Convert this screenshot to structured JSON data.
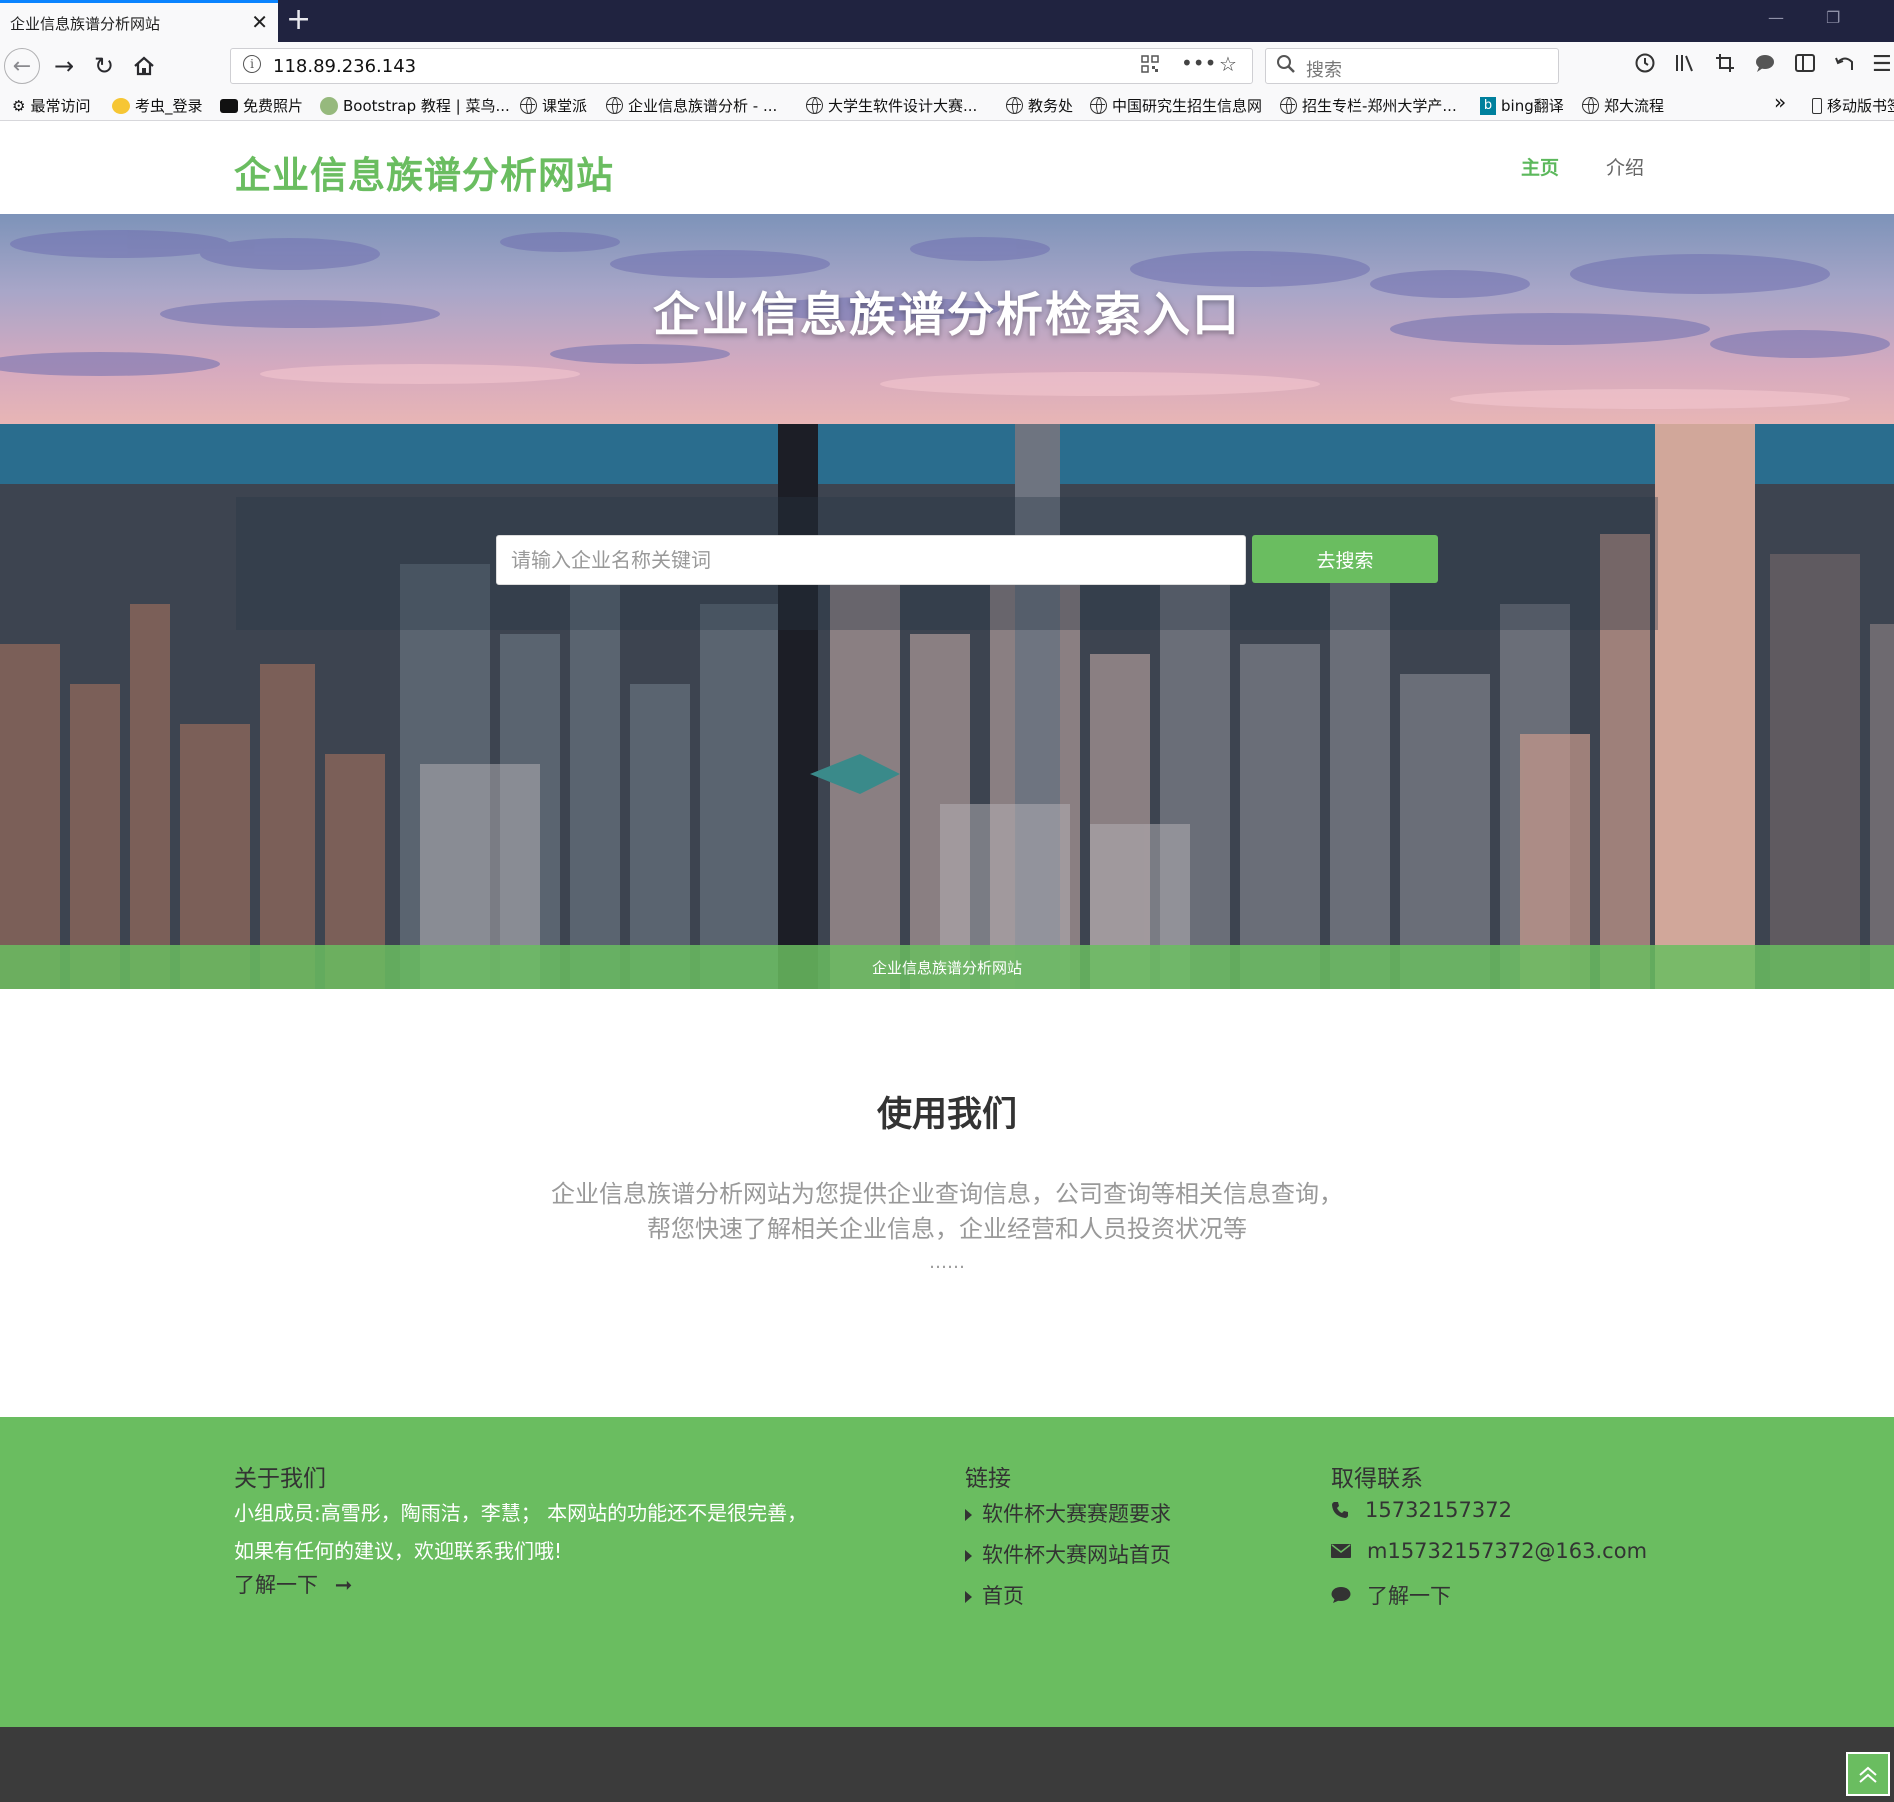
{
  "browser": {
    "tab_title": "企业信息族谱分析网站",
    "tab_close": "✕",
    "new_tab": "+",
    "url": "118.89.236.143",
    "search_placeholder": "搜索",
    "bookmarks": [
      {
        "label": "最常访问",
        "icon": "gear-icon"
      },
      {
        "label": "考虫_登录",
        "icon": "kaochong-icon"
      },
      {
        "label": "免费照片",
        "icon": "camera-icon"
      },
      {
        "label": "Bootstrap 教程 | 菜鸟...",
        "icon": "runoob-icon"
      },
      {
        "label": "课堂派",
        "icon": "globe-icon"
      },
      {
        "label": "企业信息族谱分析 - ...",
        "icon": "globe-icon"
      },
      {
        "label": "大学生软件设计大赛...",
        "icon": "globe-icon"
      },
      {
        "label": "教务处",
        "icon": "globe-icon"
      },
      {
        "label": "中国研究生招生信息网",
        "icon": "globe-icon"
      },
      {
        "label": "招生专栏-郑州大学产...",
        "icon": "globe-icon"
      },
      {
        "label": "bing翻译",
        "icon": "bing-icon"
      },
      {
        "label": "郑大流程",
        "icon": "globe-icon"
      }
    ],
    "overflow": "»",
    "mobile_bookmarks": "移动版书签"
  },
  "site": {
    "brand": "企业信息族谱分析网站",
    "menu": {
      "home": "主页",
      "intro": "介绍"
    },
    "accent_color": "#6abd60"
  },
  "hero": {
    "title": "企业信息族谱分析检索入口",
    "search_placeholder": "请输入企业名称关键词",
    "search_button": "去搜索",
    "bar_text": "企业信息族谱分析网站"
  },
  "about": {
    "title": "使用我们",
    "line1": "企业信息族谱分析网站为您提供企业查询信息，公司查询等相关信息查询，",
    "line2": "帮您快速了解相关企业信息，企业经营和人员投资状况等",
    "dots": "……"
  },
  "footer": {
    "about_title": "关于我们",
    "about_line1": "小组成员:高雪彤，陶雨洁，李慧； 本网站的功能还不是很完善，",
    "about_line2": "如果有任何的建议，欢迎联系我们哦!",
    "about_more": "了解一下",
    "links_title": "链接",
    "links": [
      "软件杯大赛赛题要求",
      "软件杯大赛网站首页",
      "首页"
    ],
    "contact_title": "取得联系",
    "phone": "15732157372",
    "email": "m15732157372@163.com",
    "contact_more": "了解一下"
  }
}
